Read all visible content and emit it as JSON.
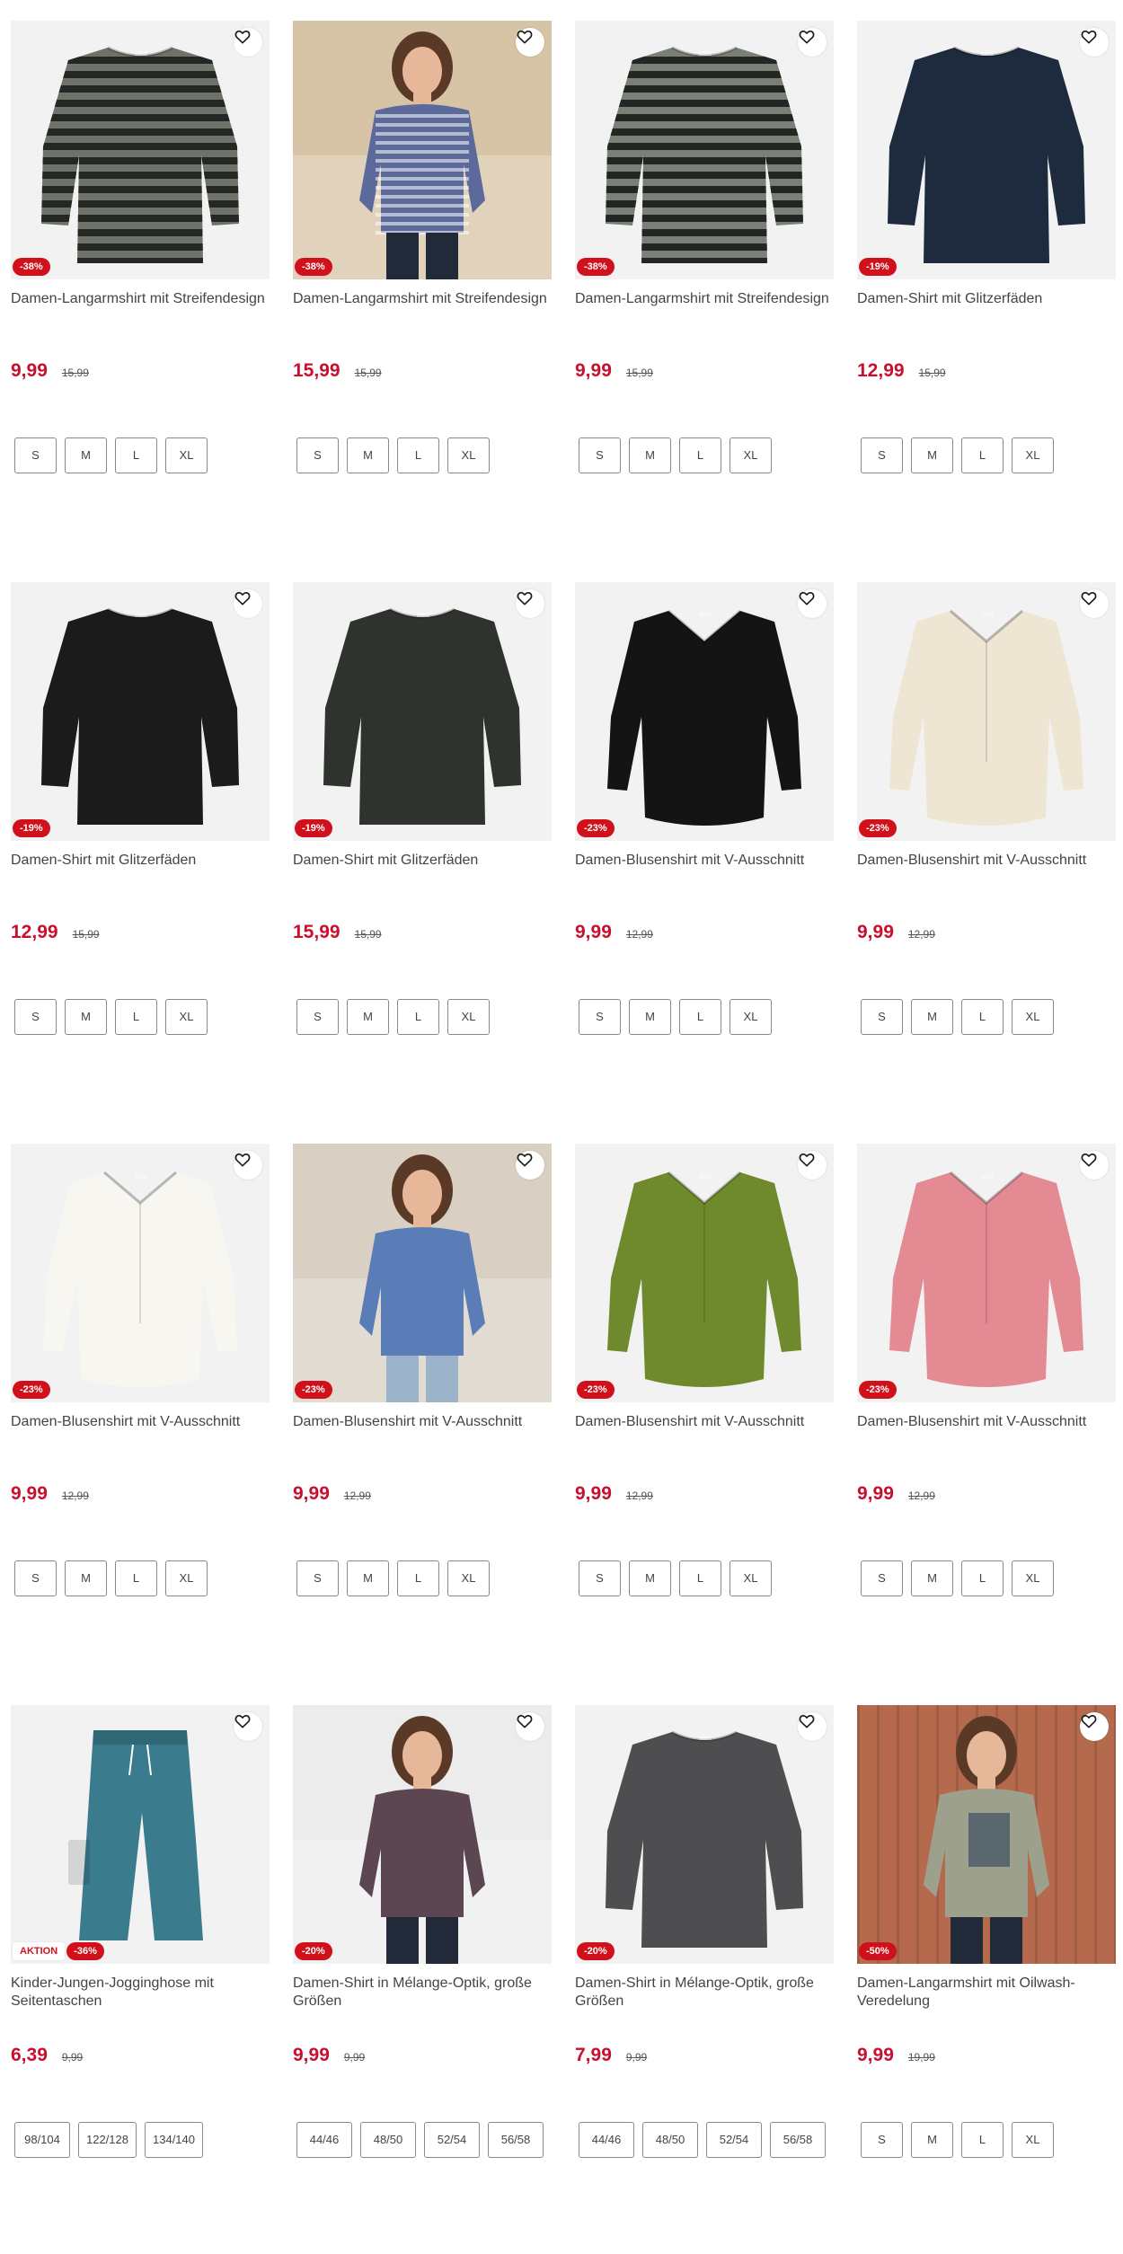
{
  "products": [
    {
      "title": "Damen-Langarmshirt mit Streifendesign",
      "price": "9,99",
      "old_price": "15,99",
      "badges": [
        "-38%"
      ],
      "sizes": [
        "S",
        "M",
        "L",
        "XL"
      ],
      "image": "shirt-striped",
      "colors": {
        "main": "#6e7268",
        "stripe": "#242824",
        "bg": "#f2f2f2"
      }
    },
    {
      "title": "Damen-Langarmshirt mit Streifendesign",
      "price": "15,99",
      "old_price": "15,99",
      "badges": [
        "-38%"
      ],
      "sizes": [
        "S",
        "M",
        "L",
        "XL"
      ],
      "image": "model-striped",
      "colors": {
        "main": "#5b6a9a",
        "stripe": "#dfe3ef",
        "bg": "#d7c3a6"
      }
    },
    {
      "title": "Damen-Langarmshirt mit Streifendesign",
      "price": "9,99",
      "old_price": "15,99",
      "badges": [
        "-38%"
      ],
      "sizes": [
        "S",
        "M",
        "L",
        "XL"
      ],
      "image": "shirt-striped",
      "colors": {
        "main": "#7b8076",
        "stripe": "#232723",
        "bg": "#f2f2f2"
      }
    },
    {
      "title": "Damen-Shirt mit Glitzerfäden",
      "price": "12,99",
      "old_price": "15,99",
      "badges": [
        "-19%"
      ],
      "sizes": [
        "S",
        "M",
        "L",
        "XL"
      ],
      "image": "shirt-plain",
      "colors": {
        "main": "#1e2a3d",
        "bg": "#f2f2f2"
      }
    },
    {
      "title": "Damen-Shirt mit Glitzerfäden",
      "price": "12,99",
      "old_price": "15,99",
      "badges": [
        "-19%"
      ],
      "sizes": [
        "S",
        "M",
        "L",
        "XL"
      ],
      "image": "shirt-plain",
      "colors": {
        "main": "#1b1b1b",
        "bg": "#f2f2f2"
      }
    },
    {
      "title": "Damen-Shirt mit Glitzerfäden",
      "price": "15,99",
      "old_price": "15,99",
      "badges": [
        "-19%"
      ],
      "sizes": [
        "S",
        "M",
        "L",
        "XL"
      ],
      "image": "shirt-plain",
      "colors": {
        "main": "#2f332d",
        "bg": "#f2f2f2"
      }
    },
    {
      "title": "Damen-Blusenshirt mit V-Ausschnitt",
      "price": "9,99",
      "old_price": "12,99",
      "badges": [
        "-23%"
      ],
      "sizes": [
        "S",
        "M",
        "L",
        "XL"
      ],
      "image": "shirt-vneck",
      "colors": {
        "main": "#141414",
        "bg": "#f2f2f2"
      }
    },
    {
      "title": "Damen-Blusenshirt mit V-Ausschnitt",
      "price": "9,99",
      "old_price": "12,99",
      "badges": [
        "-23%"
      ],
      "sizes": [
        "S",
        "M",
        "L",
        "XL"
      ],
      "image": "shirt-vneck",
      "colors": {
        "main": "#eee6d2",
        "bg": "#f2f2f2"
      }
    },
    {
      "title": "Damen-Blusenshirt mit V-Ausschnitt",
      "price": "9,99",
      "old_price": "12,99",
      "badges": [
        "-23%"
      ],
      "sizes": [
        "S",
        "M",
        "L",
        "XL"
      ],
      "image": "shirt-vneck",
      "colors": {
        "main": "#f7f6f1",
        "bg": "#f2f2f2"
      }
    },
    {
      "title": "Damen-Blusenshirt mit V-Ausschnitt",
      "price": "9,99",
      "old_price": "12,99",
      "badges": [
        "-23%"
      ],
      "sizes": [
        "S",
        "M",
        "L",
        "XL"
      ],
      "image": "model-vneck",
      "colors": {
        "main": "#5a7db7",
        "bg": "#d9cfc3"
      }
    },
    {
      "title": "Damen-Blusenshirt mit V-Ausschnitt",
      "price": "9,99",
      "old_price": "12,99",
      "badges": [
        "-23%"
      ],
      "sizes": [
        "S",
        "M",
        "L",
        "XL"
      ],
      "image": "shirt-vneck",
      "colors": {
        "main": "#6f8a2c",
        "bg": "#f2f2f2"
      }
    },
    {
      "title": "Damen-Blusenshirt mit V-Ausschnitt",
      "price": "9,99",
      "old_price": "12,99",
      "badges": [
        "-23%"
      ],
      "sizes": [
        "S",
        "M",
        "L",
        "XL"
      ],
      "image": "shirt-vneck",
      "colors": {
        "main": "#e38a93",
        "bg": "#f2f2f2"
      }
    },
    {
      "title": "Kinder-Jungen-Jogginghose mit Seitentaschen",
      "price": "6,39",
      "old_price": "9,99",
      "badges": [
        "AKTION",
        "-36%"
      ],
      "sizes": [
        "98/104",
        "122/128",
        "134/140"
      ],
      "image": "pants",
      "colors": {
        "main": "#3a7b8e",
        "bg": "#f2f2f2"
      }
    },
    {
      "title": "Damen-Shirt in Mélange-Optik, große Größen",
      "price": "9,99",
      "old_price": "9,99",
      "badges": [
        "-20%"
      ],
      "sizes": [
        "44/46",
        "48/50",
        "52/54",
        "56/58"
      ],
      "image": "model-plus",
      "colors": {
        "main": "#5b4652",
        "bg": "#ececec"
      }
    },
    {
      "title": "Damen-Shirt in Mélange-Optik, große Größen",
      "price": "7,99",
      "old_price": "9,99",
      "badges": [
        "-20%"
      ],
      "sizes": [
        "44/46",
        "48/50",
        "52/54",
        "56/58"
      ],
      "image": "shirt-plain",
      "colors": {
        "main": "#4e4e50",
        "bg": "#f2f2f2"
      }
    },
    {
      "title": "Damen-Langarmshirt mit Oilwash-Veredelung",
      "price": "9,99",
      "old_price": "19,99",
      "badges": [
        "-50%"
      ],
      "sizes": [
        "S",
        "M",
        "L",
        "XL"
      ],
      "image": "model-print",
      "colors": {
        "main": "#9ea08e",
        "bg": "#b56a4d"
      }
    }
  ]
}
